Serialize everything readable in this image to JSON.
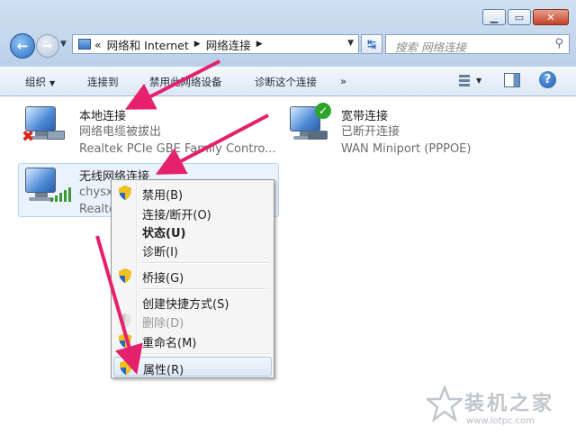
{
  "address": {
    "crumb1": "网络和 Internet",
    "crumb2": "网络连接",
    "prefix": "«"
  },
  "search": {
    "placeholder": "搜索 网络连接"
  },
  "toolbar": {
    "organize": "组织",
    "connect_to": "连接到",
    "disable_device": "禁用此网络设备",
    "diagnose": "诊断这个连接",
    "more": "»"
  },
  "connections": [
    {
      "name": "本地连接",
      "status": "网络电缆被拔出",
      "device": "Realtek PCIe GBE Family Contro..."
    },
    {
      "name": "宽带连接",
      "status": "已断开连接",
      "device": "WAN Miniport (PPPOE)"
    },
    {
      "name": "无线网络连接",
      "status": "chysx",
      "device": "Realte"
    }
  ],
  "context_menu": [
    {
      "label": "禁用(B)",
      "shield": true
    },
    {
      "label": "连接/断开(O)",
      "shield": false
    },
    {
      "label": "状态(U)",
      "shield": false,
      "bold": true
    },
    {
      "label": "诊断(I)",
      "shield": false
    },
    {
      "label": "桥接(G)",
      "shield": true
    },
    {
      "label": "创建快捷方式(S)",
      "shield": false
    },
    {
      "label": "删除(D)",
      "shield": true,
      "disabled": true
    },
    {
      "label": "重命名(M)",
      "shield": true
    },
    {
      "label": "属性(R)",
      "shield": true,
      "highlighted": true
    }
  ],
  "watermark": {
    "brand": "装机之家",
    "url": "www.lotpc.com"
  },
  "colors": {
    "arrow": "#e5206d",
    "selection": "#eaf3fd",
    "check": "#2aa52a",
    "error": "#d8261b"
  }
}
